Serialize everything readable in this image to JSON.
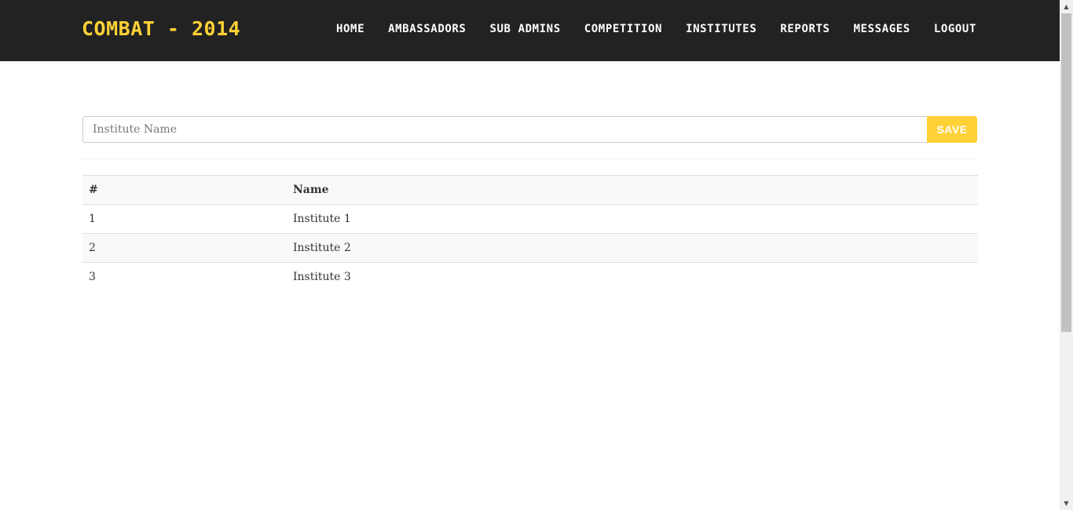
{
  "navbar": {
    "brand": "COMBAT - 2014",
    "items": [
      {
        "label": "HOME"
      },
      {
        "label": "AMBASSADORS"
      },
      {
        "label": "SUB ADMINS"
      },
      {
        "label": "COMPETITION"
      },
      {
        "label": "INSTITUTES"
      },
      {
        "label": "REPORTS"
      },
      {
        "label": "MESSAGES"
      },
      {
        "label": "LOGOUT"
      }
    ]
  },
  "form": {
    "institute_name": {
      "placeholder": "Institute Name",
      "value": ""
    },
    "save_label": "SAVE"
  },
  "table": {
    "headers": [
      "#",
      "Name"
    ],
    "rows": [
      [
        "1",
        "Institute 1"
      ],
      [
        "2",
        "Institute 2"
      ],
      [
        "3",
        "Institute 3"
      ]
    ]
  },
  "colors": {
    "navbar_bg": "#222222",
    "accent": "#fed136"
  }
}
